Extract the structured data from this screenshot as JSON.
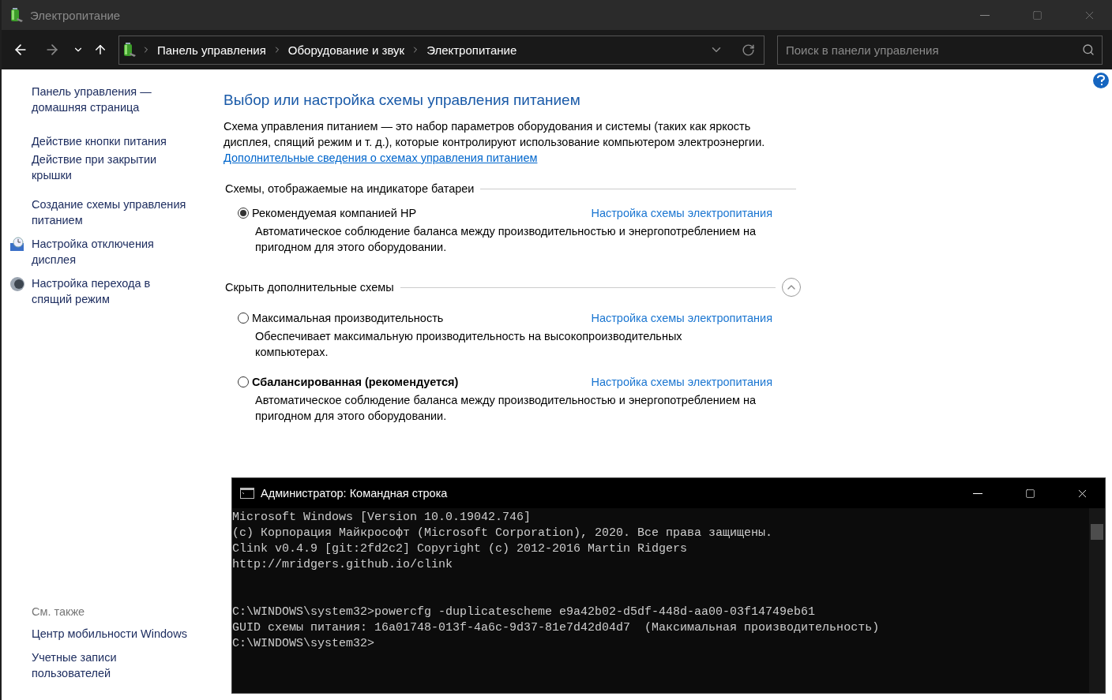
{
  "window": {
    "title": "Электропитание"
  },
  "address_bar": {
    "breadcrumbs": [
      "Панель управления",
      "Оборудование и звук",
      "Электропитание"
    ]
  },
  "search": {
    "placeholder": "Поиск в панели управления"
  },
  "sidebar": {
    "items": [
      {
        "text": "Панель управления — домашняя страница",
        "kind": "plain"
      },
      {
        "text": "Действие кнопки питания",
        "kind": "plain"
      },
      {
        "text": "Действие при закрытии крышки",
        "kind": "plain"
      },
      {
        "text": "Создание схемы управления питанием",
        "kind": "plain"
      },
      {
        "text": "Настройка отключения дисплея",
        "kind": "display"
      },
      {
        "text": "Настройка перехода в спящий режим",
        "kind": "sleep"
      }
    ],
    "see_also": {
      "title": "См. также",
      "items": [
        "Центр мобильности Windows",
        "Учетные записи пользователей"
      ]
    }
  },
  "main": {
    "heading": "Выбор или настройка схемы управления питанием",
    "description": "Схема управления питанием — это набор параметров оборудования и системы (таких как яркость дисплея, спящий режим и т. д.), которые контролируют использование компьютером электроэнергии.",
    "link": "Дополнительные сведения о схемах управления питанием",
    "groups": [
      {
        "title": "Схемы, отображаемые на индикаторе батареи",
        "schemes": [
          {
            "name": "Рекомендуемая компанией HP",
            "selected": true,
            "emphasized": false,
            "link": "Настройка схемы электропитания",
            "description": "Автоматическое соблюдение баланса между производительностью и энергопотреблением на пригодном для этого оборудовании."
          }
        ]
      },
      {
        "title": "Скрыть дополнительные схемы",
        "expanded": true,
        "schemes": [
          {
            "name": "Максимальная производительность",
            "selected": false,
            "emphasized": false,
            "link": "Настройка схемы электропитания",
            "description": "Обеспечивает максимальную производительность на высокопроизводительных компьютерах."
          },
          {
            "name": "Сбалансированная (рекомендуется)",
            "selected": false,
            "emphasized": true,
            "link": "Настройка схемы электропитания",
            "description": "Автоматическое соблюдение баланса между производительностью и энергопотреблением на пригодном для этого оборудовании."
          }
        ]
      }
    ]
  },
  "console": {
    "title": "Администратор: Командная строка",
    "blocks": [
      [
        "Microsoft Windows [Version 10.0.19042.746]",
        "(c) Корпорация Майкрософт (Microsoft Corporation), 2020. Все права защищены.",
        "Clink v0.4.9 [git:2fd2c2] Copyright (c) 2012-2016 Martin Ridgers",
        "http://mridgers.github.io/clink"
      ],
      [
        "C:\\WINDOWS\\system32>powercfg -duplicatescheme e9a42b02-d5df-448d-aa00-03f14749eb61",
        "GUID схемы питания: 16a01748-013f-4a6c-9d37-81e7d42d04d7  (Максимальная производительность)",
        "C:\\WINDOWS\\system32>"
      ]
    ]
  }
}
